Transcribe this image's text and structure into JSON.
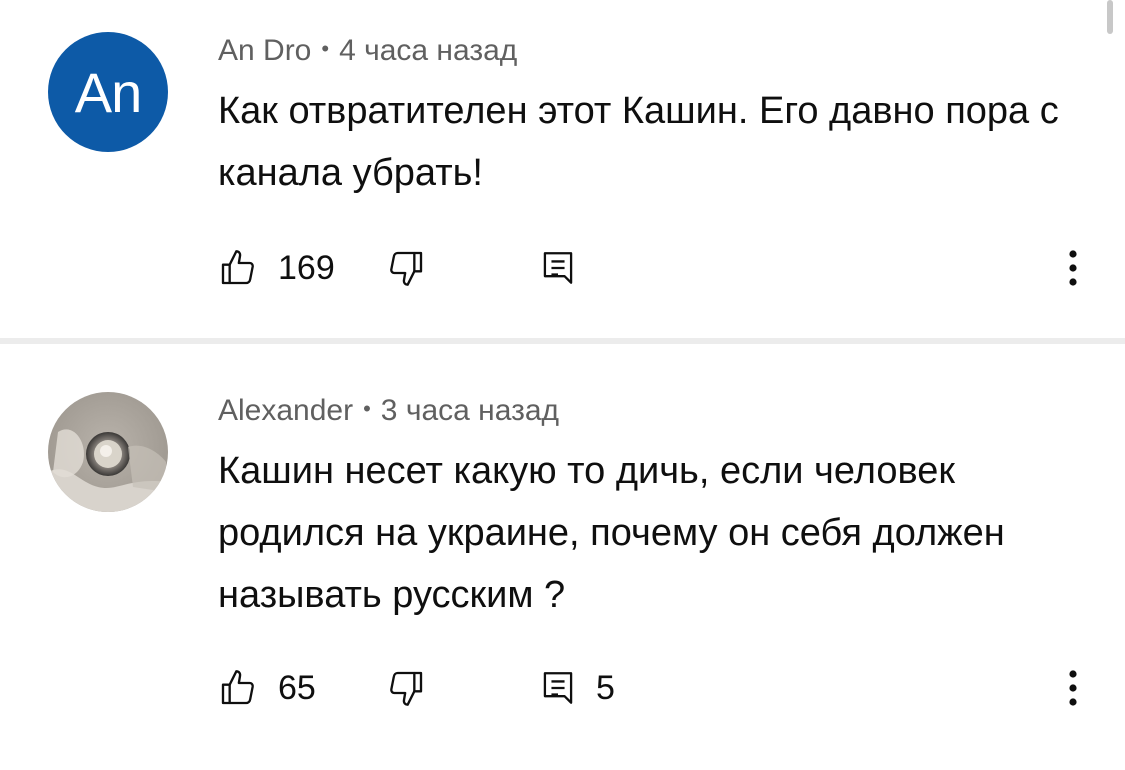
{
  "comments": [
    {
      "author": "An Dro",
      "separator": "•",
      "time": "4 часа назад",
      "avatar_initials": "An",
      "avatar_color": "#0d5aa7",
      "text": "Как отвратителен этот Кашин. Его давно пора с канала убрать!",
      "likes": "169",
      "replies": ""
    },
    {
      "author": "Alexander",
      "separator": "•",
      "time": "3 часа назад",
      "avatar_initials": "",
      "text": "Кашин несет какую то дичь, если человек родился на украине, почему он себя должен называть русским ?",
      "likes": "65",
      "replies": "5"
    }
  ],
  "icons": {
    "like": "thumbs-up-icon",
    "dislike": "thumbs-down-icon",
    "reply": "reply-icon",
    "more": "more-vert-icon"
  },
  "colors": {
    "meta_text": "#606060",
    "divider": "#ececec"
  }
}
